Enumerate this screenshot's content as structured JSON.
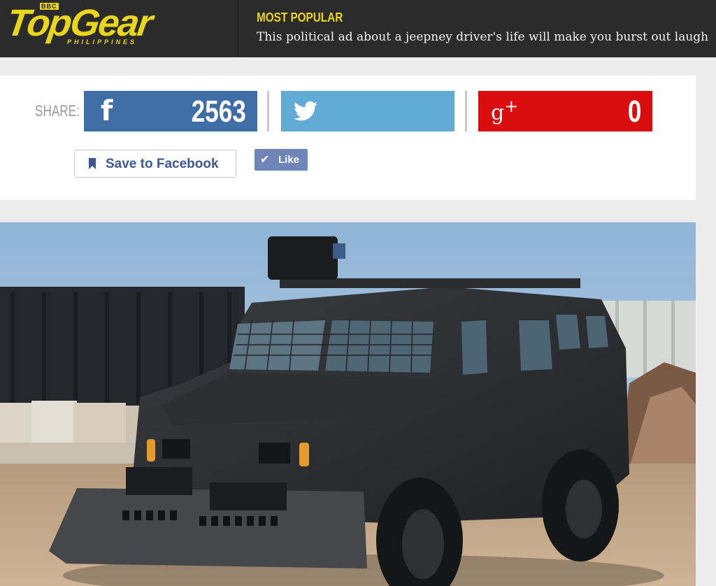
{
  "header": {
    "logo_bbc": "BBC",
    "logo_text": "TopGear",
    "logo_sub": "PHILIPPINES",
    "most_popular_label": "MOST POPULAR",
    "most_popular_headline": "This political ad about a jeepney driver's life will make you burst out laugh"
  },
  "share": {
    "label": "SHARE:",
    "facebook": {
      "icon": "facebook-icon",
      "icon_glyph": "f",
      "count": "2563",
      "color": "#3f6ea7"
    },
    "twitter": {
      "icon": "twitter-icon",
      "color": "#62aad6"
    },
    "googleplus": {
      "icon": "googleplus-icon",
      "icon_glyph": "g",
      "count": "0",
      "color": "#d90d0d"
    },
    "save_to_facebook": "Save to Facebook",
    "like": "Like"
  },
  "colors": {
    "brand_yellow": "#e8d51c",
    "header_bg": "#2b2b2b"
  }
}
